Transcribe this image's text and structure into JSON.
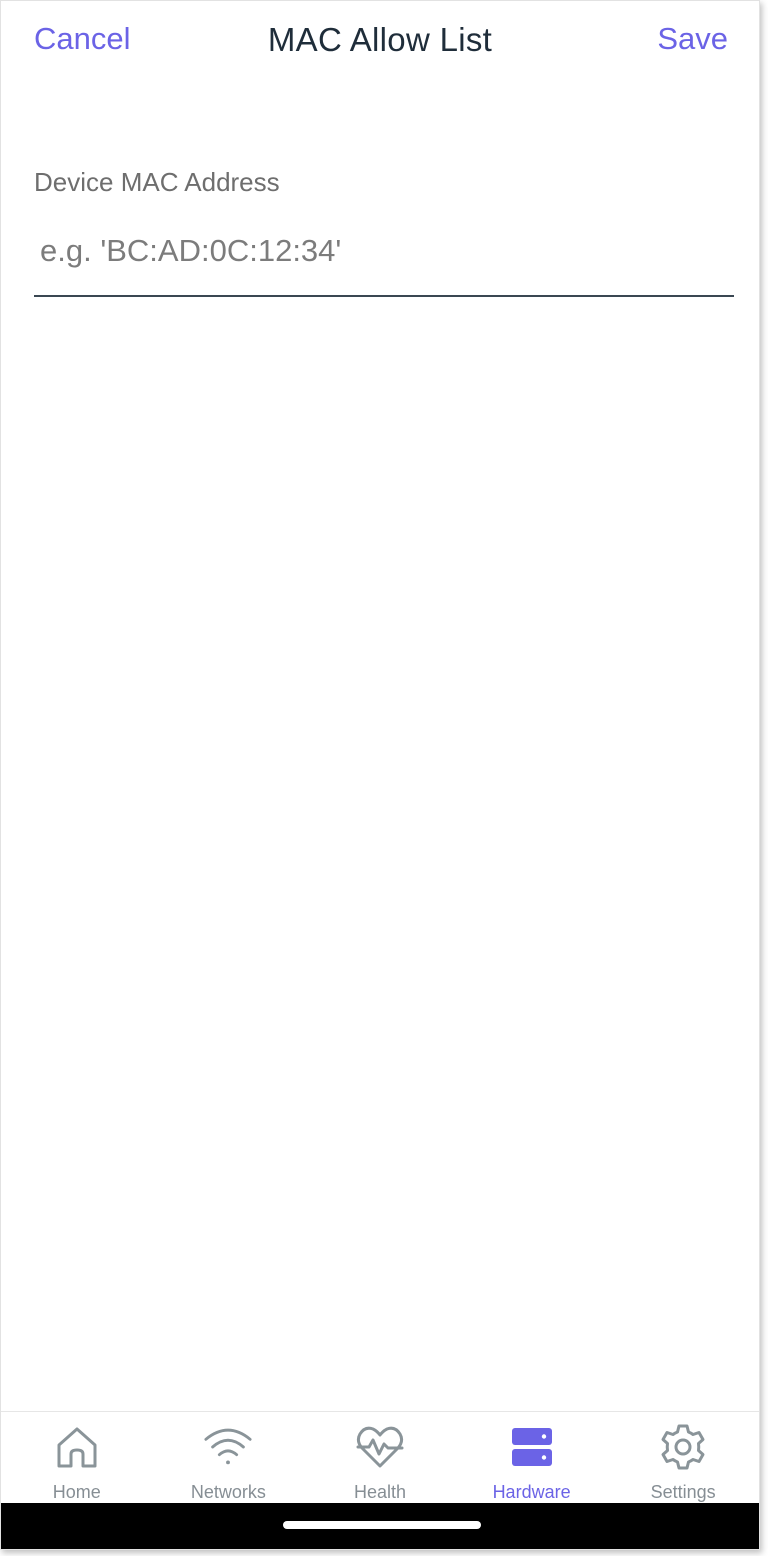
{
  "header": {
    "cancel_label": "Cancel",
    "title": "MAC Allow List",
    "save_label": "Save"
  },
  "form": {
    "mac_label": "Device MAC Address",
    "mac_value": "",
    "mac_placeholder": "e.g. 'BC:AD:0C:12:34'"
  },
  "tabs": [
    {
      "label": "Home",
      "icon": "home-icon",
      "active": false
    },
    {
      "label": "Networks",
      "icon": "wifi-icon",
      "active": false
    },
    {
      "label": "Health",
      "icon": "heart-pulse-icon",
      "active": false
    },
    {
      "label": "Hardware",
      "icon": "server-icon",
      "active": true
    },
    {
      "label": "Settings",
      "icon": "gear-icon",
      "active": false
    }
  ],
  "colors": {
    "accent": "#6b63e6",
    "inactive_icon": "#8a9499",
    "title": "#1f2d3a"
  }
}
